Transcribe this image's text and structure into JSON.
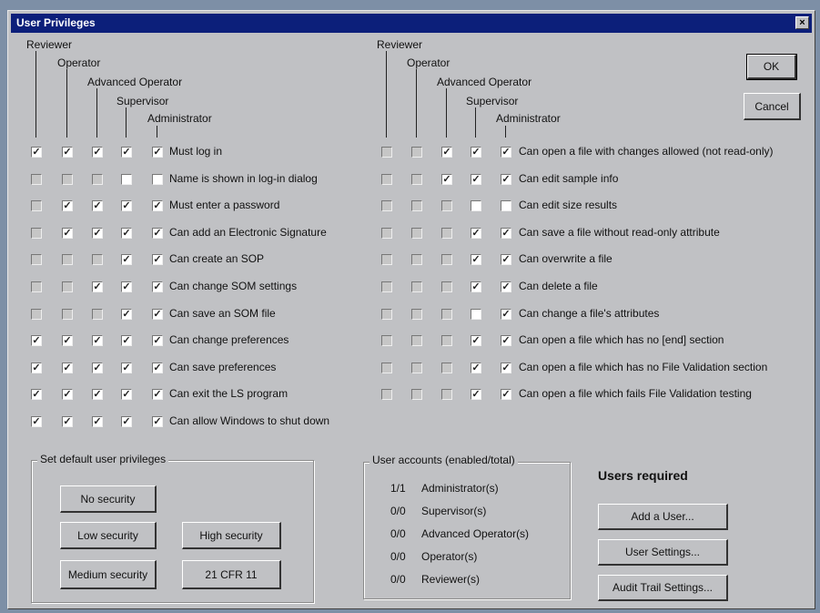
{
  "dialog": {
    "title": "User Privileges",
    "close_glyph": "×"
  },
  "roles": [
    "Reviewer",
    "Operator",
    "Advanced Operator",
    "Supervisor",
    "Administrator"
  ],
  "left_privileges": [
    {
      "label": "Must log in",
      "checks": [
        true,
        true,
        true,
        true,
        true
      ]
    },
    {
      "label": "Name is shown in log-in dialog",
      "checks": [
        false,
        false,
        false,
        false,
        false
      ]
    },
    {
      "label": "Must enter a password",
      "checks": [
        false,
        true,
        true,
        true,
        true
      ]
    },
    {
      "label": "Can add an Electronic Signature",
      "checks": [
        false,
        true,
        true,
        true,
        true
      ]
    },
    {
      "label": "Can create an SOP",
      "checks": [
        false,
        false,
        false,
        true,
        true
      ]
    },
    {
      "label": "Can change SOM settings",
      "checks": [
        false,
        false,
        true,
        true,
        true
      ]
    },
    {
      "label": "Can save an SOM file",
      "checks": [
        false,
        false,
        false,
        true,
        true
      ]
    },
    {
      "label": "Can change preferences",
      "checks": [
        true,
        true,
        true,
        true,
        true
      ]
    },
    {
      "label": "Can save preferences",
      "checks": [
        true,
        true,
        true,
        true,
        true
      ]
    },
    {
      "label": "Can exit the LS program",
      "checks": [
        true,
        true,
        true,
        true,
        true
      ]
    },
    {
      "label": "Can allow Windows to shut down",
      "checks": [
        true,
        true,
        true,
        true,
        true
      ]
    }
  ],
  "right_privileges": [
    {
      "label": "Can open a file with changes allowed (not read-only)",
      "checks": [
        false,
        false,
        true,
        true,
        true
      ]
    },
    {
      "label": "Can edit sample info",
      "checks": [
        false,
        false,
        true,
        true,
        true
      ]
    },
    {
      "label": "Can edit size results",
      "checks": [
        false,
        false,
        false,
        false,
        false
      ]
    },
    {
      "label": "Can save a file without read-only attribute",
      "checks": [
        false,
        false,
        false,
        true,
        true
      ]
    },
    {
      "label": "Can overwrite a file",
      "checks": [
        false,
        false,
        false,
        true,
        true
      ]
    },
    {
      "label": "Can delete a file",
      "checks": [
        false,
        false,
        false,
        true,
        true
      ]
    },
    {
      "label": "Can change a file's attributes",
      "checks": [
        false,
        false,
        false,
        false,
        true
      ]
    },
    {
      "label": "Can open a file which has no [end] section",
      "checks": [
        false,
        false,
        false,
        true,
        true
      ]
    },
    {
      "label": "Can open a file which has no File Validation section",
      "checks": [
        false,
        false,
        false,
        true,
        true
      ]
    },
    {
      "label": "Can open a file which fails File Validation testing",
      "checks": [
        false,
        false,
        false,
        true,
        true
      ]
    }
  ],
  "buttons": {
    "ok": "OK",
    "cancel": "Cancel"
  },
  "defaults": {
    "title": "Set default user privileges",
    "no_security": "No security",
    "low_security": "Low security",
    "high_security": "High security",
    "medium_security": "Medium security",
    "cfr": "21 CFR 11"
  },
  "accounts": {
    "title": "User accounts (enabled/total)",
    "items": [
      {
        "count": "1/1",
        "role": "Administrator(s)"
      },
      {
        "count": "0/0",
        "role": "Supervisor(s)"
      },
      {
        "count": "0/0",
        "role": "Advanced Operator(s)"
      },
      {
        "count": "0/0",
        "role": "Operator(s)"
      },
      {
        "count": "0/0",
        "role": "Reviewer(s)"
      }
    ]
  },
  "users": {
    "required_label": "Users required",
    "add_user": "Add a User...",
    "user_settings": "User Settings...",
    "audit_trail": "Audit Trail Settings..."
  },
  "colors": {
    "titlebar": "#0c1f7a",
    "face": "#c0c1c4"
  }
}
